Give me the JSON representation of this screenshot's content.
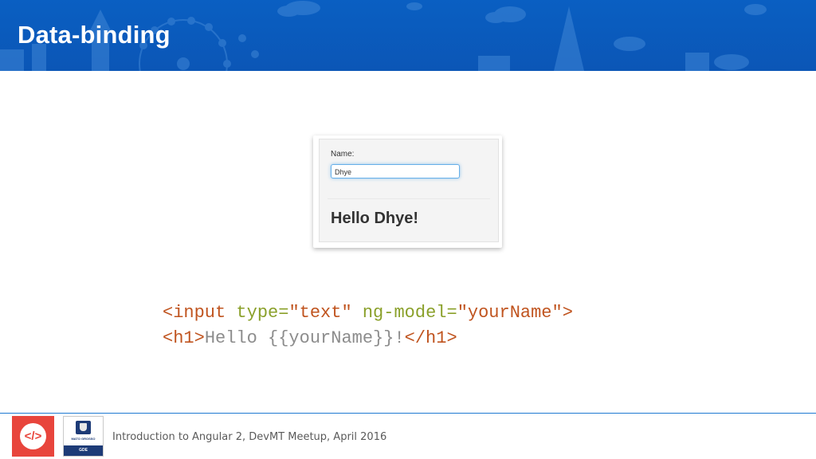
{
  "slide": {
    "title": "Data-binding"
  },
  "demo": {
    "label": "Name:",
    "input_value": "Dhye",
    "output": "Hello Dhye!"
  },
  "code": {
    "line1": {
      "open": "<input ",
      "attr1": "type=",
      "val1": "\"text\"",
      "space": " ",
      "attr2": "ng-model=",
      "val2": "\"yourName\"",
      "close": ">"
    },
    "line2": {
      "open": "<h1>",
      "text": "Hello {{yourName}}!",
      "close": "</h1>"
    }
  },
  "footer": {
    "logo_red_text": "</>",
    "logo_gde_name": "MATO GROSSO",
    "logo_gde_bar": "GDE",
    "caption": "Introduction to Angular 2, DevMT Meetup, April 2016"
  },
  "colors": {
    "header": "#0b56b6",
    "tag": "#c0541f",
    "attribute": "#8aa02a",
    "plain_text": "#8c8c8c",
    "footer_line": "#1e7ad2",
    "logo_red": "#e8453c"
  },
  "icons": {
    "header_decoration": "city-skyline-illustration",
    "logo_left": "code-brackets-icon",
    "logo_right": "gde-emblem-icon"
  }
}
